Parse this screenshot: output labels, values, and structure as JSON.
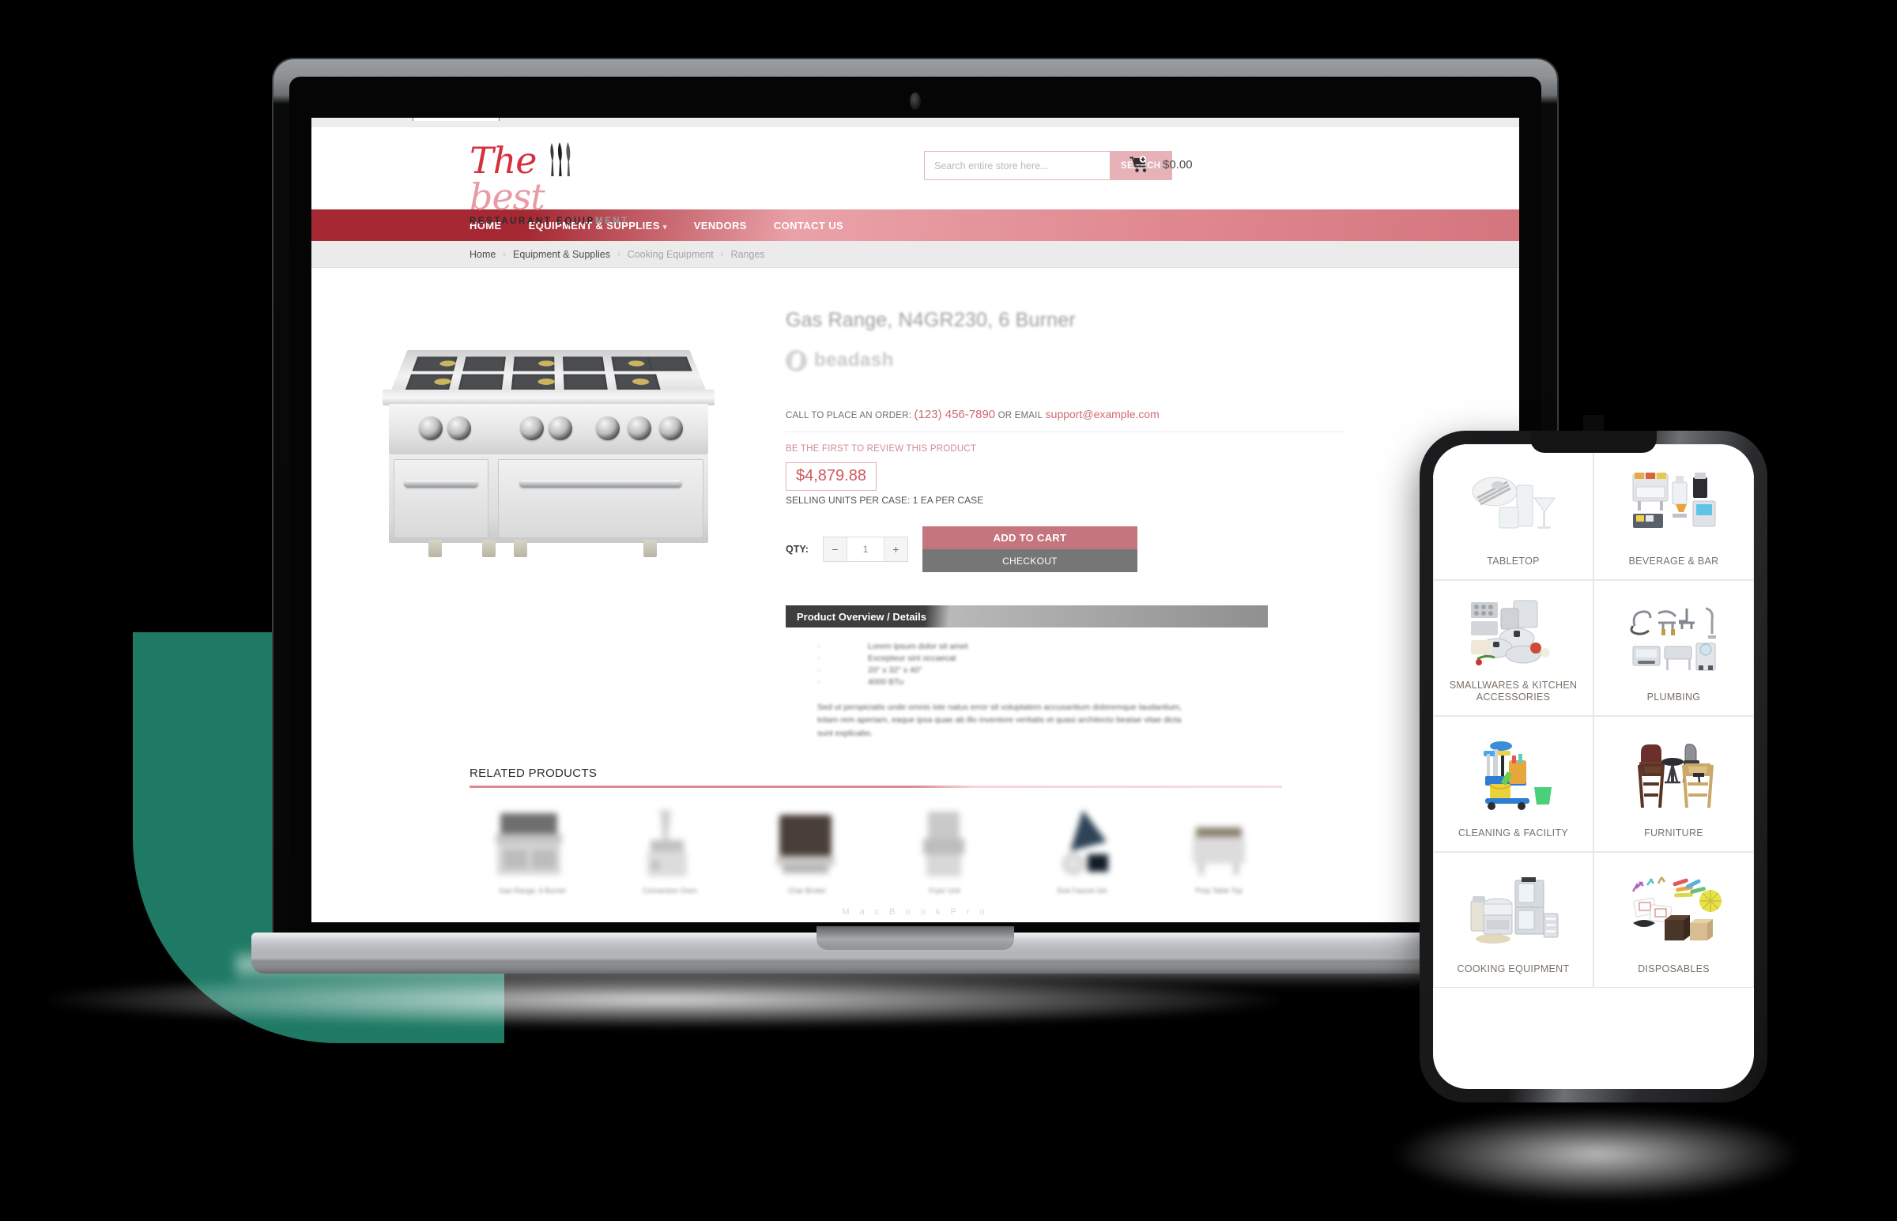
{
  "brand": {
    "logo_the": "The",
    "logo_best": "best",
    "logo_sub_dark": "RESTAURANT EQUIP",
    "logo_sub_grey": "MENT",
    "accent_red": "#a52833",
    "accent_pink": "#e6b2b8",
    "accent_teal": "#1f7a65"
  },
  "header": {
    "search": {
      "placeholder": "Search entire store here...",
      "value": "",
      "button_label": "SEARCH"
    },
    "cart": {
      "icon": "shopping-cart-plus-icon",
      "total": "$0.00"
    }
  },
  "nav": {
    "items": [
      {
        "label": "HOME",
        "has_caret": false
      },
      {
        "label": "EQUIPMENT & SUPPLIES",
        "has_caret": true
      },
      {
        "label": "VENDORS",
        "has_caret": false
      },
      {
        "label": "CONTACT US",
        "has_caret": false
      }
    ],
    "caret_glyph": "▾"
  },
  "breadcrumb": {
    "separator": "›",
    "items": [
      {
        "label": "Home",
        "muted": false
      },
      {
        "label": "Equipment & Supplies",
        "muted": false
      },
      {
        "label": "Cooking Equipment",
        "muted": true
      },
      {
        "label": "Ranges",
        "muted": true
      }
    ]
  },
  "product": {
    "title": "Gas Range, N4GR230, 6 Burner",
    "brand_logo_name": "beadash",
    "brand_logo_icon": "beadash-circle-icon",
    "image_name": "gas-range-6-burner-photo",
    "call_prefix": "CALL TO PLACE AN ORDER:",
    "phone": "(123) 456-7890",
    "call_mid": "OR EMAIL",
    "email": "support@example.com",
    "review_link": "BE THE FIRST TO REVIEW THIS PRODUCT",
    "price": "$4,879.88",
    "units_label": "SELLING UNITS PER CASE: 1 EA PER CASE",
    "qty_label": "QTY:",
    "qty_value": "1",
    "qty_minus": "−",
    "qty_plus": "+",
    "add_to_cart_label": "ADD TO CART",
    "checkout_label": "CHECKOUT"
  },
  "overview": {
    "heading": "Product Overview / Details",
    "bullets": [
      "Lorem ipsum dolor sit amet",
      "Excepteur sint occaecat",
      "20\" x 32\" x 40\"",
      "4000 BTu"
    ],
    "paragraph": "Sed ut perspiciatis unde omnis iste natus error sit voluptatem accusantium doloremque laudantium, totam rem aperiam, eaque ipsa quae ab illo inventore veritatis et quasi architecto beatae vitae dicta sunt explicabo."
  },
  "related": {
    "title": "RELATED PRODUCTS",
    "items": [
      {
        "label": "Gas Range, 6 Burner",
        "art": "range"
      },
      {
        "label": "Convection Oven",
        "art": "mixer"
      },
      {
        "label": "Char Broiler",
        "art": "griddle"
      },
      {
        "label": "Fryer Unit",
        "art": "fryer"
      },
      {
        "label": "Sink Faucet Set",
        "art": "faucet"
      },
      {
        "label": "Prep Table Top",
        "art": "table"
      }
    ]
  },
  "mobile": {
    "categories": [
      {
        "label": "TABLETOP",
        "art": "tabletop"
      },
      {
        "label": "BEVERAGE & BAR",
        "art": "beverage"
      },
      {
        "label": "SMALLWARES & KITCHEN ACCESSORIES",
        "art": "smallwares"
      },
      {
        "label": "PLUMBING",
        "art": "plumbing"
      },
      {
        "label": "CLEANING & FACILITY",
        "art": "cleaning"
      },
      {
        "label": "FURNITURE",
        "art": "furniture"
      },
      {
        "label": "COOKING EQUIPMENT",
        "art": "cooking"
      },
      {
        "label": "DISPOSABLES",
        "art": "disposables"
      }
    ]
  },
  "device": {
    "laptop_hinge_text": "M a c B o o k   P r o"
  }
}
